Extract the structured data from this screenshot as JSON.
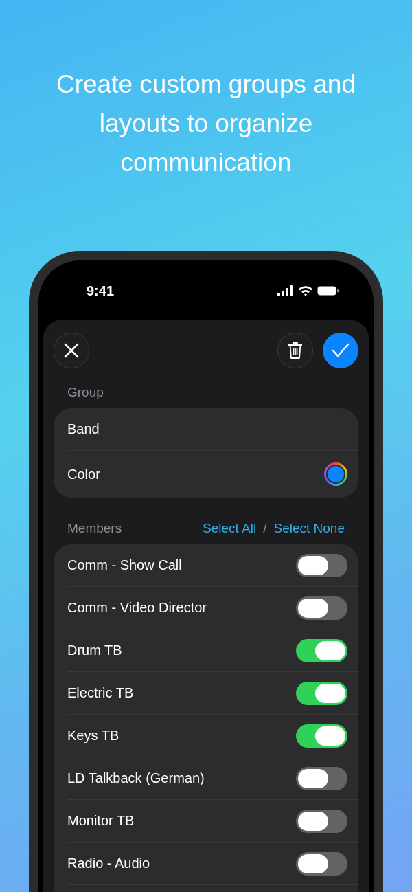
{
  "headline": "Create custom groups and layouts to organize communication",
  "status_bar": {
    "time": "9:41"
  },
  "group": {
    "header": "Group",
    "name": "Band",
    "color_label": "Color",
    "color": "#0a84ff"
  },
  "members": {
    "header": "Members",
    "select_all": "Select All",
    "separator": "/",
    "select_none": "Select None",
    "items": [
      {
        "name": "Comm - Show Call",
        "on": false
      },
      {
        "name": "Comm - Video Director",
        "on": false
      },
      {
        "name": "Drum TB",
        "on": true
      },
      {
        "name": "Electric TB",
        "on": true
      },
      {
        "name": "Keys TB",
        "on": true
      },
      {
        "name": "LD Talkback (German)",
        "on": false
      },
      {
        "name": "Monitor TB",
        "on": false
      },
      {
        "name": "Radio - Audio",
        "on": false
      }
    ]
  }
}
